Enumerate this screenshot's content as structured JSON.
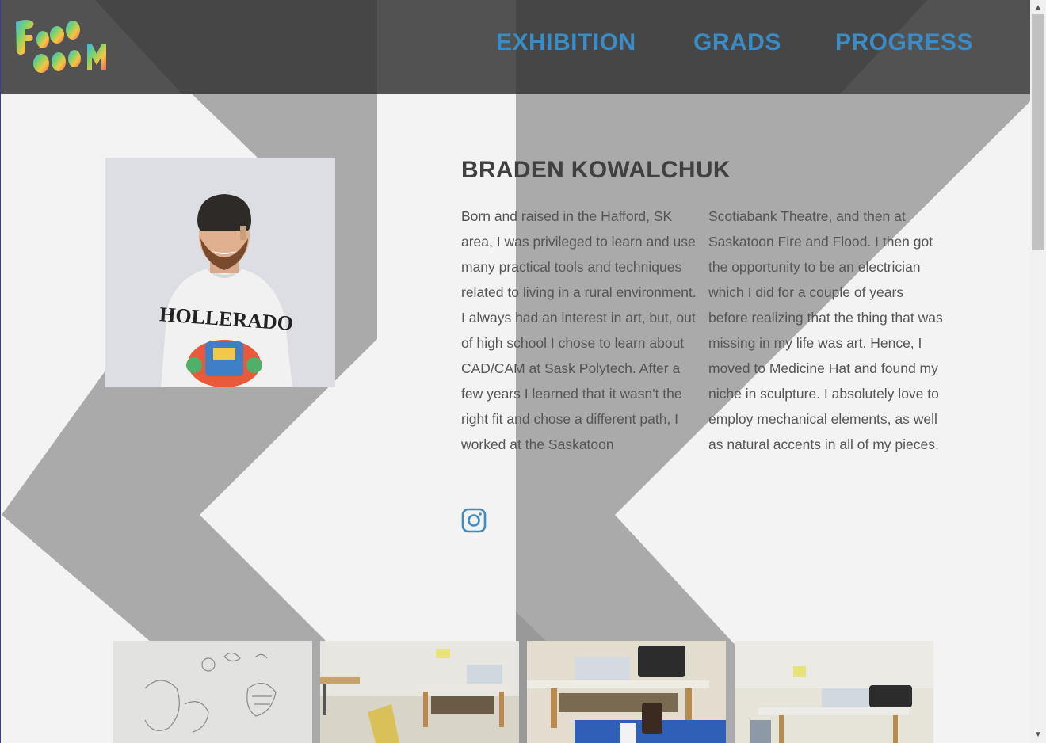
{
  "site": {
    "logo_text": "FreeFORM",
    "nav": [
      {
        "label": "EXHIBITION"
      },
      {
        "label": "GRADS"
      },
      {
        "label": "PROGRESS"
      }
    ]
  },
  "artist": {
    "name": "BRADEN KOWALCHUK",
    "portrait_alt": "Portrait of Braden Kowalchuk",
    "shirt_text": "HOLLERADO",
    "bio_col1": "Born and raised in the Hafford, SK area, I was privileged to learn and use many practical tools and techniques related to living in a rural environment. I always had an interest in art, but, out of high school I chose to learn about CAD/CAM at Sask Polytech. After a few years I learned that it wasn't the right fit and chose a different path, I worked at the Saskatoon",
    "bio_col2": "Scotiabank Theatre, and then at Saskatoon Fire and Flood. I then got the opportunity to be an electrician which I did for a couple of years before realizing that the thing that was missing in my life was art. Hence, I moved to Medicine Hat and found my niche in sculpture. I absolutely love to employ mechanical elements, as well as natural accents in all of my pieces.",
    "social_icon": "instagram-icon"
  },
  "gallery": [
    {
      "alt": "pencil sketch on wall"
    },
    {
      "alt": "studio workspace with table"
    },
    {
      "alt": "studio bench with blue tarp"
    },
    {
      "alt": "studio corner with shelving"
    }
  ],
  "colors": {
    "accent": "#3b8cc4",
    "header_bg": "#484848",
    "chevron": "#aaaaaa",
    "page_bg": "#f3f3f3"
  }
}
